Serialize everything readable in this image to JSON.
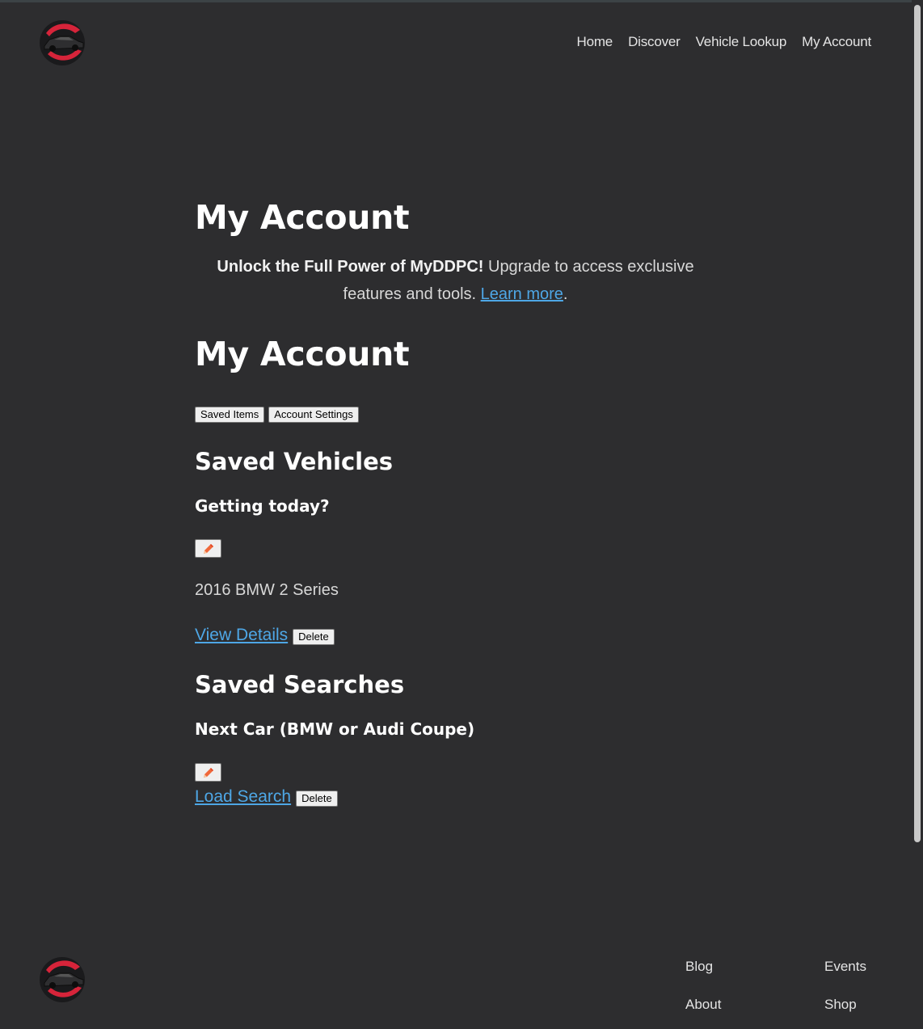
{
  "header": {
    "nav": [
      "Home",
      "Discover",
      "Vehicle Lookup",
      "My Account"
    ]
  },
  "main": {
    "title": "My Account",
    "promo": {
      "bold": "Unlock the Full Power of MyDDPC!",
      "text": " Upgrade to access exclusive features and tools. ",
      "link": "Learn more",
      "end": "."
    },
    "title2": "My Account",
    "tabs": [
      "Saved Items",
      "Account Settings"
    ],
    "saved_vehicles": {
      "heading": "Saved Vehicles",
      "item": {
        "name": "Getting today?",
        "vehicle": "2016 BMW 2 Series",
        "link": "View Details",
        "delete": "Delete"
      }
    },
    "saved_searches": {
      "heading": "Saved Searches",
      "item": {
        "name": "Next Car (BMW or Audi Coupe)",
        "link": "Load Search",
        "delete": "Delete"
      }
    }
  },
  "footer": {
    "links": [
      "Blog",
      "Events",
      "About",
      "Shop"
    ]
  },
  "colors": {
    "background": "#2d2d2f",
    "link": "#4ea7e6",
    "logo_accent": "#d6243a"
  }
}
